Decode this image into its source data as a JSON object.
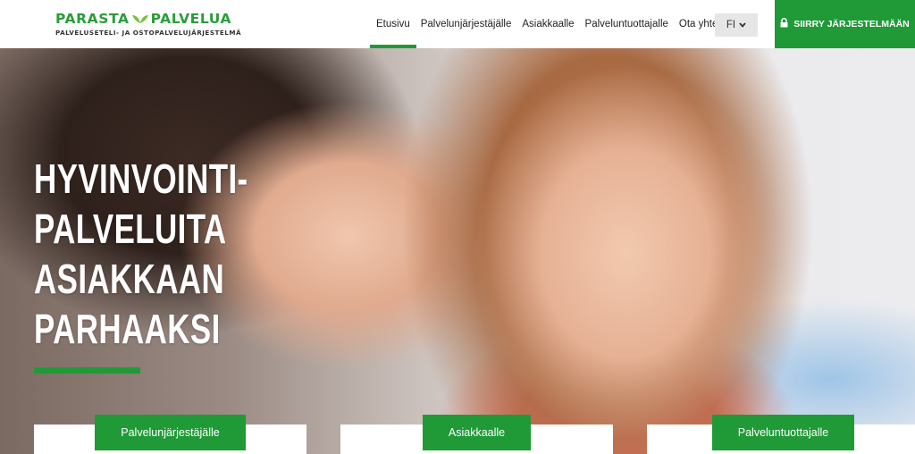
{
  "logo": {
    "name_left": "PARASTA",
    "name_right": "PALVELUA",
    "tagline": "PALVELUSETELI- JA OSTOPALVELUJÄRJESTELMÄ"
  },
  "nav": {
    "items": [
      {
        "label": "Etusivu",
        "active": true
      },
      {
        "label": "Palvelunjärjestäjälle",
        "active": false
      },
      {
        "label": "Asiakkaalle",
        "active": false
      },
      {
        "label": "Palveluntuottajalle",
        "active": false
      },
      {
        "label": "Ota yhteyttä",
        "active": false
      }
    ],
    "language": "FI",
    "language_icon": "chevron-down-icon",
    "cta_label": "SIIRRY JÄRJESTELMÄÄN",
    "cta_icon": "lock-icon"
  },
  "hero": {
    "title_lines": [
      "HYVINVOINTI-",
      "PALVELUITA",
      "ASIAKKAAN",
      "PARHAAKSI"
    ],
    "image_description_icon": "hero-photo"
  },
  "cards": [
    {
      "label": "Palvelunjärjestäjälle"
    },
    {
      "label": "Asiakkaalle"
    },
    {
      "label": "Palveluntuottajalle"
    }
  ],
  "colors": {
    "brand_green": "#1f9a37",
    "logo_green": "#2a9d3a",
    "language_bg": "#e6e6e6"
  }
}
